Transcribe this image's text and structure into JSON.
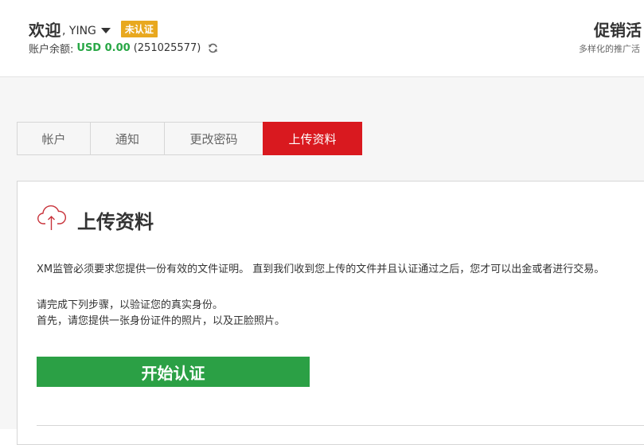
{
  "header": {
    "welcome": "欢迎",
    "username": ", YING",
    "verification_badge": "未认证",
    "balance_label": "账户余额:",
    "balance_amount": "USD 0.00",
    "account_number": "(251025577)",
    "promo_title": "促销活",
    "promo_subtitle": "多样化的推广活"
  },
  "tabs": [
    {
      "label": "帐户",
      "active": false
    },
    {
      "label": "通知",
      "active": false
    },
    {
      "label": "更改密码",
      "active": false
    },
    {
      "label": "上传资料",
      "active": true
    }
  ],
  "panel": {
    "title": "上传资料",
    "notice": "XM监管必须要求您提供一份有效的文件证明。 直到我们收到您上传的文件并且认证通过之后，您才可以出金或者进行交易。",
    "step_line1": "请完成下列步骤，以验证您的真实身份。",
    "step_line2": "首先，请您提供一张身份证件的照片，以及正脸照片。",
    "start_button": "开始认证"
  },
  "colors": {
    "accent_red": "#d9191f",
    "badge_orange": "#e8a81f",
    "balance_green": "#28a745",
    "button_green": "#2ba045"
  },
  "icons": {
    "dropdown": "caret-down-icon",
    "refresh": "refresh-icon",
    "upload": "cloud-upload-icon"
  }
}
